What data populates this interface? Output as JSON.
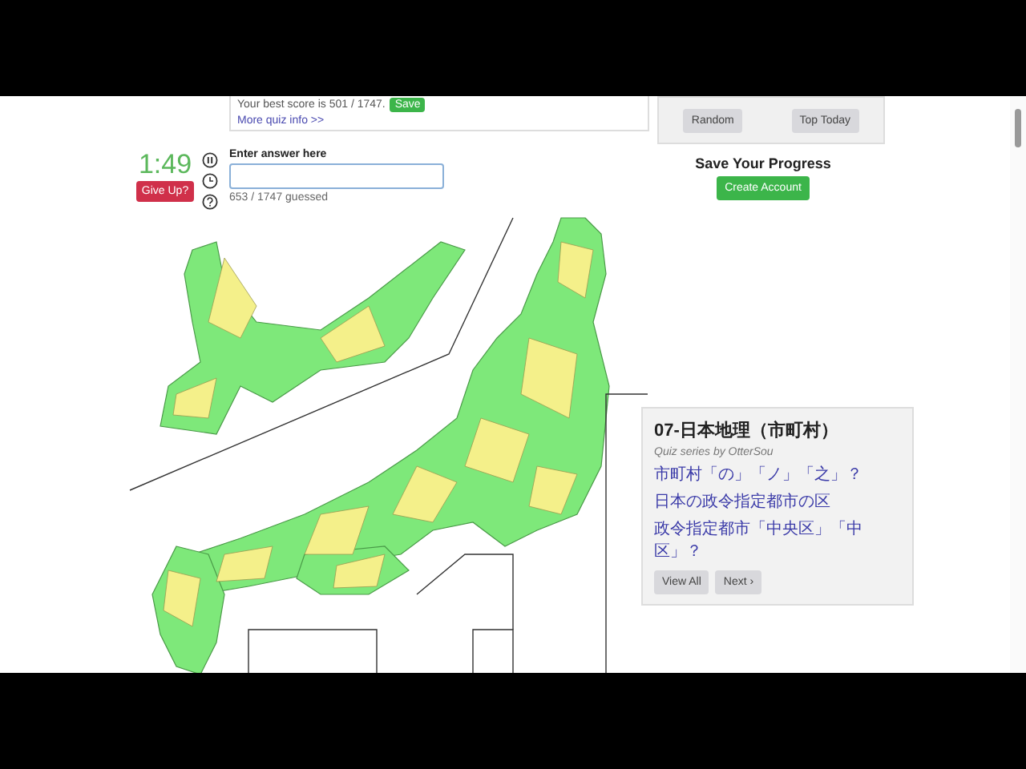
{
  "best_score": {
    "text": "Your best score is 501 / 1747.",
    "button": "Save"
  },
  "more_info_link": "More quiz info >>",
  "quick_buttons": [
    "Random",
    "Top Today"
  ],
  "timer": "1:49",
  "give_up_button": "Give Up?",
  "answer": {
    "label": "Enter answer here"
  },
  "guessed": "653 / 1747 guessed",
  "save_progress": {
    "title": "Save Your Progress",
    "button": "Create Account"
  },
  "quiz_series": {
    "title": "07-日本地理（市町村）",
    "subtitle": "Quiz series by OtterSou",
    "links": [
      "市町村「の」「ノ」「之」？",
      "日本の政令指定都市の区",
      "政令指定都市「中央区」「中区」？"
    ],
    "buttons": [
      "View All",
      "Next ›"
    ]
  }
}
